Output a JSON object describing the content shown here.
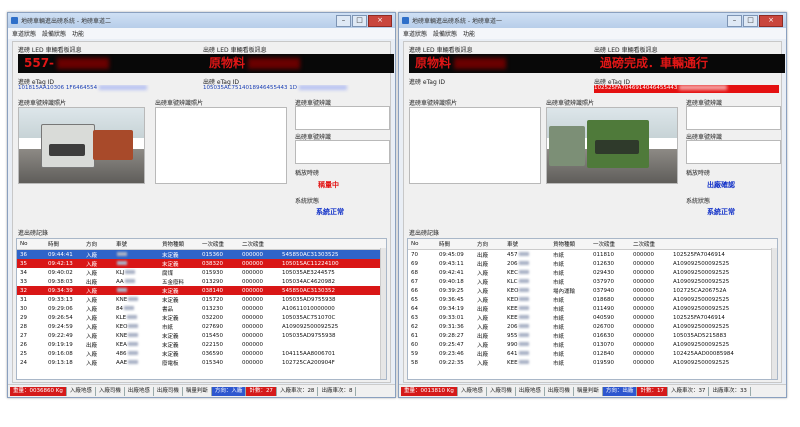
{
  "windows": [
    {
      "title": "地磅車輛進出磅系統 - 地磅車道二",
      "menu": [
        "車道狀態",
        "設備狀態",
        "功能"
      ],
      "in_led_label": "進磅 LED 車輛看板訊息",
      "in_led_text": "557-",
      "out_led_label": "出磅 LED 車輛看板訊息",
      "out_led_text": "原物料",
      "in_etag_label": "進磅 eTag ID",
      "in_etag_value": "101815AA10306 1F6464554",
      "out_etag_label": "出磅 eTag ID",
      "out_etag_value": "105035AC7514018946455443 1D",
      "in_photo_label": "進磅車號辨識照片",
      "out_photo_label": "出磅車號辨識照片",
      "in_plate_label": "進磅車號辨識",
      "out_plate_label": "出磅車號辨識",
      "weigh_status_label": "稱放時磅",
      "weigh_status_value": "稱量中",
      "system_status_label": "系統狀態",
      "system_status_value": "系統正常",
      "log_label": "進出磅記錄",
      "columns": [
        "No",
        "時間",
        "方向",
        "車號",
        "貨物種類",
        "一次磅重",
        "二次磅重",
        ""
      ],
      "rows": [
        {
          "no": "36",
          "time": "09:44:41",
          "dir": "入廠",
          "plate": "",
          "cargo": "末定義",
          "w1": "015360",
          "w2": "000000",
          "tag": "545850AC31303525",
          "style": "sel"
        },
        {
          "no": "35",
          "time": "09:42:13",
          "dir": "入廠",
          "plate": "",
          "cargo": "末定義",
          "w1": "038320",
          "w2": "000000",
          "tag": "10501SAC11224100",
          "style": "hot"
        },
        {
          "no": "34",
          "time": "09:40:02",
          "dir": "入廠",
          "plate": "KLJ",
          "cargo": "腐煤",
          "w1": "015930",
          "w2": "000000",
          "tag": "105035AE3244575",
          "style": ""
        },
        {
          "no": "33",
          "time": "09:38:03",
          "dir": "出廠",
          "plate": "AA",
          "cargo": "五金廢料",
          "w1": "013290",
          "w2": "000000",
          "tag": "105034AC4620982",
          "style": ""
        },
        {
          "no": "32",
          "time": "09:34:39",
          "dir": "入廠",
          "plate": "",
          "cargo": "末定義",
          "w1": "038140",
          "w2": "000000",
          "tag": "545850AC3130352",
          "style": "hot"
        },
        {
          "no": "31",
          "time": "09:33:13",
          "dir": "入廠",
          "plate": "KNE",
          "cargo": "末定義",
          "w1": "015720",
          "w2": "000000",
          "tag": "105035AD9755938",
          "style": ""
        },
        {
          "no": "30",
          "time": "09:29:06",
          "dir": "入廠",
          "plate": "84",
          "cargo": "書品",
          "w1": "013230",
          "w2": "000000",
          "tag": "A10611010000000",
          "style": ""
        },
        {
          "no": "29",
          "time": "09:26:54",
          "dir": "入廠",
          "plate": "KLE",
          "cargo": "末定義",
          "w1": "032200",
          "w2": "000000",
          "tag": "105035AC751070C",
          "style": ""
        },
        {
          "no": "28",
          "time": "09:24:59",
          "dir": "入廠",
          "plate": "KEO",
          "cargo": "市紙",
          "w1": "027690",
          "w2": "000000",
          "tag": "A109092500092525",
          "style": ""
        },
        {
          "no": "27",
          "time": "09:22:49",
          "dir": "入廠",
          "plate": "KNE",
          "cargo": "末定義",
          "w1": "015450",
          "w2": "000000",
          "tag": "105035AD9755938",
          "style": ""
        },
        {
          "no": "26",
          "time": "09:19:19",
          "dir": "出廠",
          "plate": "KEA",
          "cargo": "末定義",
          "w1": "022150",
          "w2": "000000",
          "tag": "",
          "style": ""
        },
        {
          "no": "25",
          "time": "09:16:08",
          "dir": "入廠",
          "plate": "486",
          "cargo": "末定義",
          "w1": "036590",
          "w2": "000000",
          "tag": "104115AA8006701",
          "style": ""
        },
        {
          "no": "24",
          "time": "09:13:18",
          "dir": "入廠",
          "plate": "AAE",
          "cargo": "廢電板",
          "w1": "015340",
          "w2": "000000",
          "tag": "102725CA200904F",
          "style": ""
        }
      ],
      "statusbar": [
        {
          "text": "重量：0036860 Kg",
          "style": "red"
        },
        {
          "text": "入廠地感",
          "style": ""
        },
        {
          "text": "入廠司機",
          "style": ""
        },
        {
          "text": "出廠地感",
          "style": ""
        },
        {
          "text": "出廠司機",
          "style": ""
        },
        {
          "text": "稱量判斷",
          "style": ""
        },
        {
          "text": "方向：入廠",
          "style": "blue"
        },
        {
          "text": "計數：27",
          "style": "red"
        },
        {
          "text": "入廠車次：28",
          "style": ""
        },
        {
          "text": "出廠車次：8",
          "style": ""
        }
      ]
    },
    {
      "title": "地磅車輛進出磅系統 - 地磅車道一",
      "menu": [
        "車道狀態",
        "設備狀態",
        "功能"
      ],
      "in_led_label": "進磅 LED 車輛看板訊息",
      "in_led_text": "原物料",
      "out_led_label": "出磅 LED 車輛看板訊息",
      "out_led_text": "過磅完成．車輛通行",
      "in_etag_label": "進磅 eTag ID",
      "in_etag_value": "",
      "out_etag_label": "出磅 eTag ID",
      "out_etag_value": "102525FA7046914046455443",
      "in_photo_label": "進磅車號辨識照片",
      "out_photo_label": "出磅車號辨識照片",
      "in_plate_label": "進磅車號辨識",
      "out_plate_label": "出磅車號辨識",
      "weigh_status_label": "稱放時磅",
      "weigh_status_value": "出廠確認",
      "system_status_label": "系統狀態",
      "system_status_value": "系統正常",
      "log_label": "進出磅記錄",
      "columns": [
        "No",
        "時間",
        "方向",
        "車號",
        "貨物種類",
        "一次磅重",
        "二次磅重",
        ""
      ],
      "rows": [
        {
          "no": "70",
          "time": "09:45:09",
          "dir": "出廠",
          "plate": "457",
          "cargo": "市紙",
          "w1": "011810",
          "w2": "000000",
          "tag": "102525FA7046914",
          "style": ""
        },
        {
          "no": "69",
          "time": "09:43:11",
          "dir": "出廠",
          "plate": "206",
          "cargo": "市紙",
          "w1": "012630",
          "w2": "000000",
          "tag": "A109092500092525",
          "style": ""
        },
        {
          "no": "68",
          "time": "09:42:41",
          "dir": "入廠",
          "plate": "KEC",
          "cargo": "市紙",
          "w1": "029430",
          "w2": "000000",
          "tag": "A109092500092525",
          "style": ""
        },
        {
          "no": "67",
          "time": "09:40:18",
          "dir": "入廠",
          "plate": "KLC",
          "cargo": "市紙",
          "w1": "037970",
          "w2": "000000",
          "tag": "A109092500092525",
          "style": ""
        },
        {
          "no": "66",
          "time": "09:39:25",
          "dir": "入廠",
          "plate": "KEO",
          "cargo": "場內運輸",
          "w1": "037940",
          "w2": "000000",
          "tag": "102725CA206752A",
          "style": ""
        },
        {
          "no": "65",
          "time": "09:36:45",
          "dir": "入廠",
          "plate": "KED",
          "cargo": "市紙",
          "w1": "018680",
          "w2": "000000",
          "tag": "A109092500092525",
          "style": ""
        },
        {
          "no": "64",
          "time": "09:34:19",
          "dir": "出廠",
          "plate": "KEE",
          "cargo": "市紙",
          "w1": "011490",
          "w2": "000000",
          "tag": "A109092500092525",
          "style": ""
        },
        {
          "no": "63",
          "time": "09:33:01",
          "dir": "入廠",
          "plate": "KEE",
          "cargo": "市紙",
          "w1": "040590",
          "w2": "000000",
          "tag": "102525FA7046914",
          "style": ""
        },
        {
          "no": "62",
          "time": "09:31:36",
          "dir": "入廠",
          "plate": "206",
          "cargo": "市紙",
          "w1": "026700",
          "w2": "000000",
          "tag": "A109092500092525",
          "style": ""
        },
        {
          "no": "61",
          "time": "09:28:27",
          "dir": "出廠",
          "plate": "955",
          "cargo": "市紙",
          "w1": "016630",
          "w2": "000000",
          "tag": "105035AD5215883",
          "style": ""
        },
        {
          "no": "60",
          "time": "09:25:47",
          "dir": "入廠",
          "plate": "990",
          "cargo": "市紙",
          "w1": "013070",
          "w2": "000000",
          "tag": "A109092500092525",
          "style": ""
        },
        {
          "no": "59",
          "time": "09:23:46",
          "dir": "出廠",
          "plate": "641",
          "cargo": "市紙",
          "w1": "012840",
          "w2": "000000",
          "tag": "102425AAD00085984",
          "style": ""
        },
        {
          "no": "58",
          "time": "09:22:35",
          "dir": "入廠",
          "plate": "KEE",
          "cargo": "市紙",
          "w1": "019590",
          "w2": "000000",
          "tag": "A109092500092525",
          "style": ""
        }
      ],
      "statusbar": [
        {
          "text": "重量：0013810 Kg",
          "style": "red"
        },
        {
          "text": "入廠地感",
          "style": ""
        },
        {
          "text": "入廠司機",
          "style": ""
        },
        {
          "text": "出廠地感",
          "style": ""
        },
        {
          "text": "出廠司機",
          "style": ""
        },
        {
          "text": "稱量判斷",
          "style": ""
        },
        {
          "text": "方向：出廠",
          "style": "blue"
        },
        {
          "text": "計數：17",
          "style": "red"
        },
        {
          "text": "入廠車次：37",
          "style": ""
        },
        {
          "text": "出廠車次：33",
          "style": ""
        }
      ]
    }
  ]
}
